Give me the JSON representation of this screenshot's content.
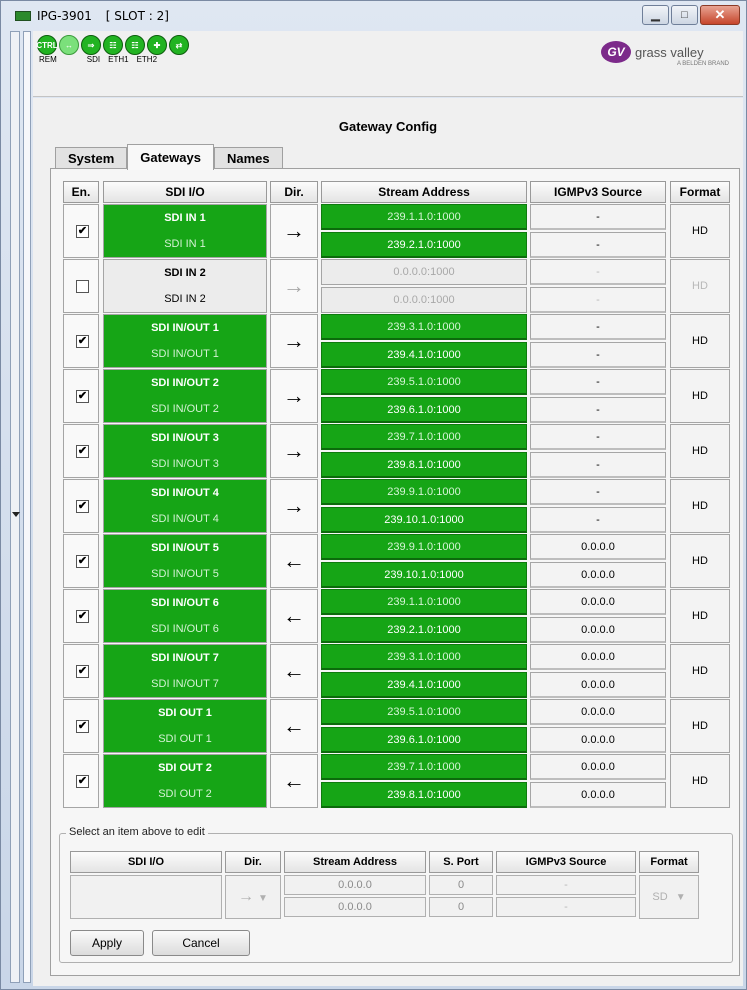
{
  "window": {
    "title": "IPG-3901",
    "slot": "[ SLOT : 2]"
  },
  "status": {
    "labels": [
      "REM",
      "SDI",
      "ETH1",
      "ETH2"
    ],
    "ctrl_label": "CTRL"
  },
  "logo": {
    "text": "grass valley",
    "sub": "A BELDEN BRAND",
    "mark": "GV"
  },
  "page_title": "Gateway Config",
  "tabs": [
    {
      "label": "System"
    },
    {
      "label": "Gateways",
      "active": true
    },
    {
      "label": "Names"
    }
  ],
  "grid": {
    "headers": {
      "en": "En.",
      "sdi": "SDI I/O",
      "dir": "Dir.",
      "addr": "Stream Address",
      "igmp": "IGMPv3 Source",
      "fmt": "Format"
    },
    "rows": [
      {
        "enabled": true,
        "name1": "SDI IN 1",
        "name2": "SDI IN 1",
        "dir": "→",
        "addr1": "239.1.1.0:1000",
        "addr2": "239.2.1.0:1000",
        "igmp1": "-",
        "igmp2": "-",
        "fmt": "HD"
      },
      {
        "enabled": false,
        "name1": "SDI IN 2",
        "name2": "SDI IN 2",
        "dir": "→",
        "addr1": "0.0.0.0:1000",
        "addr2": "0.0.0.0:1000",
        "igmp1": "-",
        "igmp2": "-",
        "fmt": "HD"
      },
      {
        "enabled": true,
        "name1": "SDI IN/OUT 1",
        "name2": "SDI IN/OUT 1",
        "dir": "→",
        "addr1": "239.3.1.0:1000",
        "addr2": "239.4.1.0:1000",
        "igmp1": "-",
        "igmp2": "-",
        "fmt": "HD"
      },
      {
        "enabled": true,
        "name1": "SDI IN/OUT 2",
        "name2": "SDI IN/OUT 2",
        "dir": "→",
        "addr1": "239.5.1.0:1000",
        "addr2": "239.6.1.0:1000",
        "igmp1": "-",
        "igmp2": "-",
        "fmt": "HD"
      },
      {
        "enabled": true,
        "name1": "SDI IN/OUT 3",
        "name2": "SDI IN/OUT 3",
        "dir": "→",
        "addr1": "239.7.1.0:1000",
        "addr2": "239.8.1.0:1000",
        "igmp1": "-",
        "igmp2": "-",
        "fmt": "HD"
      },
      {
        "enabled": true,
        "name1": "SDI IN/OUT 4",
        "name2": "SDI IN/OUT 4",
        "dir": "→",
        "addr1": "239.9.1.0:1000",
        "addr2": "239.10.1.0:1000",
        "igmp1": "-",
        "igmp2": "-",
        "fmt": "HD"
      },
      {
        "enabled": true,
        "name1": "SDI IN/OUT 5",
        "name2": "SDI IN/OUT 5",
        "dir": "←",
        "addr1": "239.9.1.0:1000",
        "addr2": "239.10.1.0:1000",
        "igmp1": "0.0.0.0",
        "igmp2": "0.0.0.0",
        "fmt": "HD"
      },
      {
        "enabled": true,
        "name1": "SDI IN/OUT 6",
        "name2": "SDI IN/OUT 6",
        "dir": "←",
        "addr1": "239.1.1.0:1000",
        "addr2": "239.2.1.0:1000",
        "igmp1": "0.0.0.0",
        "igmp2": "0.0.0.0",
        "fmt": "HD"
      },
      {
        "enabled": true,
        "name1": "SDI IN/OUT 7",
        "name2": "SDI IN/OUT 7",
        "dir": "←",
        "addr1": "239.3.1.0:1000",
        "addr2": "239.4.1.0:1000",
        "igmp1": "0.0.0.0",
        "igmp2": "0.0.0.0",
        "fmt": "HD"
      },
      {
        "enabled": true,
        "name1": "SDI OUT 1",
        "name2": "SDI OUT 1",
        "dir": "←",
        "addr1": "239.5.1.0:1000",
        "addr2": "239.6.1.0:1000",
        "igmp1": "0.0.0.0",
        "igmp2": "0.0.0.0",
        "fmt": "HD"
      },
      {
        "enabled": true,
        "name1": "SDI OUT 2",
        "name2": "SDI OUT 2",
        "dir": "←",
        "addr1": "239.7.1.0:1000",
        "addr2": "239.8.1.0:1000",
        "igmp1": "0.0.0.0",
        "igmp2": "0.0.0.0",
        "fmt": "HD"
      }
    ]
  },
  "edit": {
    "legend": "Select an item above to edit",
    "headers": {
      "sdi": "SDI I/O",
      "dir": "Dir.",
      "addr": "Stream Address",
      "port": "S. Port",
      "igmp": "IGMPv3 Source",
      "fmt": "Format"
    },
    "dir_value": "→",
    "addr1": "0.0.0.0",
    "addr2": "0.0.0.0",
    "port1": "0",
    "port2": "0",
    "igmp1": "-",
    "igmp2": "-",
    "fmt": "SD",
    "apply_label": "Apply",
    "cancel_label": "Cancel"
  },
  "colors": {
    "active_green": "#16a516",
    "disabled_gray": "#ececec"
  }
}
